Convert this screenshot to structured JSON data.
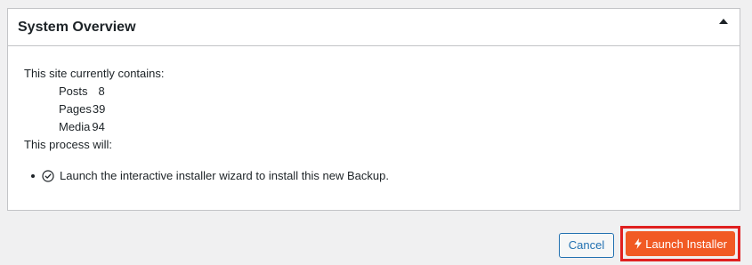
{
  "panel": {
    "title": "System Overview"
  },
  "body": {
    "intro": "This site currently contains:",
    "stats": [
      {
        "label": "Posts",
        "value": "8"
      },
      {
        "label": "Pages",
        "value": "39"
      },
      {
        "label": "Media",
        "value": "94"
      }
    ],
    "process_label": "This process will:",
    "steps": [
      {
        "text": "Launch the interactive installer wizard to install this new Backup."
      }
    ]
  },
  "actions": {
    "cancel_label": "Cancel",
    "launch_label": "Launch Installer"
  },
  "colors": {
    "accent": "#f15a24",
    "link": "#2271b1",
    "highlight": "#e02020"
  },
  "icons": {
    "toggle": "caret-up-icon",
    "step": "check-circle-icon",
    "launch": "bolt-icon"
  }
}
